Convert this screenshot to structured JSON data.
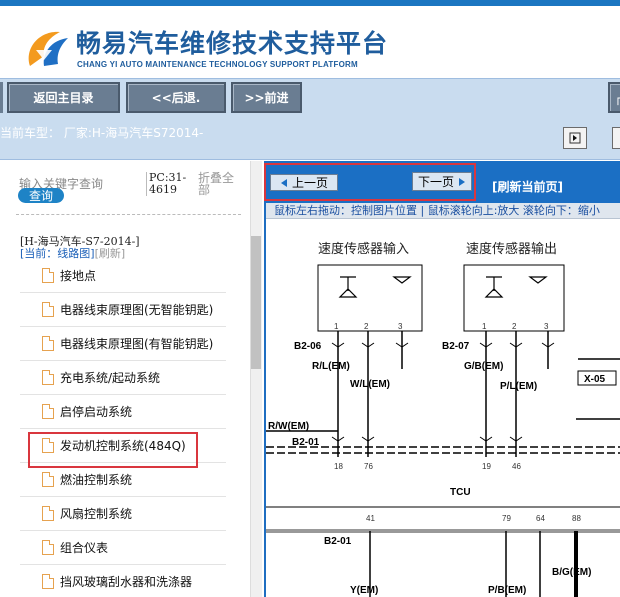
{
  "header": {
    "title": "畅易汽车维修技术支持平台",
    "subtitle": "CHANG YI AUTO MAINTENANCE TECHNOLOGY SUPPORT PLATFORM"
  },
  "toolbar": {
    "home_label": "返回主目录",
    "back_label": "<<后退.",
    "forward_label": ">>前进",
    "edge_label": "┌"
  },
  "info": {
    "car_label": "当前车型：  厂家:H-海马汽车S72014-"
  },
  "sidebar": {
    "search_placeholder": "输入关键字查询",
    "search_button": "查询",
    "pc_label": "PC:31-\n4619",
    "fold_label": "折叠全\n部",
    "car_model": "[H-海马汽车-S7-2014-]",
    "current_path": "[当前：线路图]",
    "refresh_link": "[刷新]",
    "items": [
      {
        "label": "接地点"
      },
      {
        "label": "电器线束原理图(无智能钥匙)"
      },
      {
        "label": "电器线束原理图(有智能钥匙)"
      },
      {
        "label": "充电系统/起动系统"
      },
      {
        "label": "启停启动系统"
      },
      {
        "label": "发动机控制系统(484Q)"
      },
      {
        "label": "燃油控制系统"
      },
      {
        "label": "风扇控制系统"
      },
      {
        "label": "组合仪表"
      },
      {
        "label": "挡风玻璃刮水器和洗涤器"
      }
    ],
    "selected_index": 5
  },
  "diagram": {
    "prev_label": "上一页",
    "next_label": "下一页",
    "refresh_label": "[刷新当前页]",
    "hint": "鼠标左右拖动：控制图片位置 | 鼠标滚轮向上:放大  滚轮向下：缩小",
    "labels": {
      "speed_in": "速度传感器输入",
      "speed_out": "速度传感器输出",
      "b2_06": "B2-06",
      "b2_07": "B2-07",
      "b2_01": "B2-01",
      "b2_01b": "B2-01",
      "rl_em": "R/L(EM)",
      "wl_em": "W/L(EM)",
      "gb_em": "G/B(EM)",
      "pl_em": "P/L(EM)",
      "rw_em": "R/W(EM)",
      "x05": "X-05",
      "tcu": "TCU",
      "y_em": "Y(EM)",
      "pb_em": "P/B(EM)",
      "bg_em": "B/G(EM)",
      "pin1a": "1",
      "pin2a": "2",
      "pin3a": "3",
      "pin1b": "1",
      "pin2b": "2",
      "pin3b": "3",
      "pin18": "18",
      "pin76": "76",
      "pin19": "19",
      "pin46": "46",
      "pin41": "41",
      "pin79": "79",
      "pin64": "64",
      "pin88": "88"
    }
  },
  "colors": {
    "brand_blue": "#1f5d9d",
    "header_bar": "#1b6fc4",
    "toolbar_bg": "#c9dcef",
    "highlight_red": "#d9363e",
    "icon_orange": "#e6a24f"
  }
}
